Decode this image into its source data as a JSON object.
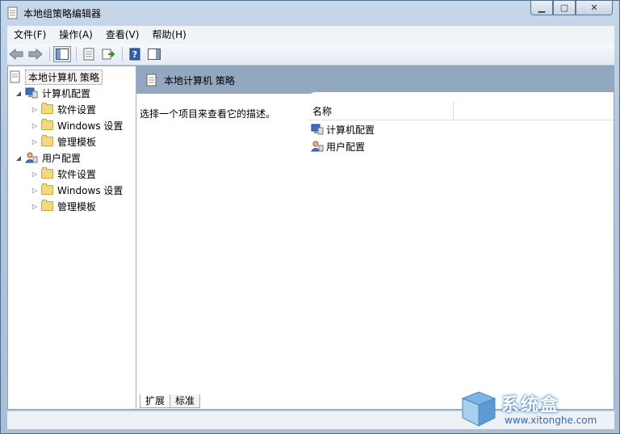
{
  "window": {
    "title": "本地组策略编辑器"
  },
  "menu": [
    "文件(F)",
    "操作(A)",
    "查看(V)",
    "帮助(H)"
  ],
  "tree": {
    "root": "本地计算机 策略",
    "computer": {
      "label": "计算机配置",
      "children": [
        "软件设置",
        "Windows 设置",
        "管理模板"
      ]
    },
    "user": {
      "label": "用户配置",
      "children": [
        "软件设置",
        "Windows 设置",
        "管理模板"
      ]
    }
  },
  "right": {
    "header": "本地计算机 策略",
    "description": "选择一个项目来查看它的描述。",
    "column_name": "名称",
    "items": [
      "计算机配置",
      "用户配置"
    ],
    "tabs": [
      "扩展",
      "标准"
    ]
  },
  "watermark": {
    "text": "系统盒",
    "url": "www.xitonghe.com"
  },
  "colors": {
    "header_bg": "#92a8c0",
    "frame": "#b5c8dd"
  }
}
